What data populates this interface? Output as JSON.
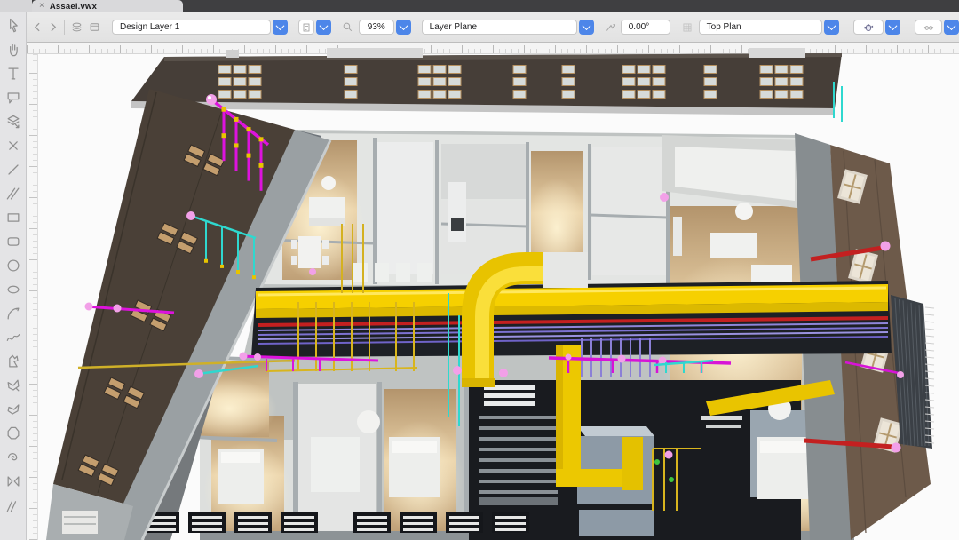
{
  "window": {
    "tab_title": "Assael.vwx",
    "close_glyph": "×"
  },
  "toolbar": {
    "accent": "#4d86e9",
    "layer_select": "Design Layer 1",
    "zoom_level": "93%",
    "plane_select": "Layer Plane",
    "rotation_angle": "0.00°",
    "view_select": "Top Plan"
  },
  "palette": {
    "tools": [
      {
        "id": "selection"
      },
      {
        "id": "pan"
      },
      {
        "id": "text"
      },
      {
        "id": "callout"
      },
      {
        "id": "working-plane"
      },
      {
        "id": "delete"
      },
      {
        "id": "line"
      },
      {
        "id": "double-line"
      },
      {
        "id": "rectangle"
      },
      {
        "id": "rounded-rectangle"
      },
      {
        "id": "circle"
      },
      {
        "id": "ellipse"
      },
      {
        "id": "arc"
      },
      {
        "id": "freehand"
      },
      {
        "id": "polyline"
      },
      {
        "id": "reshape-polygon"
      },
      {
        "id": "polygon"
      },
      {
        "id": "regular-polygon"
      },
      {
        "id": "spiral"
      },
      {
        "id": "mirror"
      },
      {
        "id": "hatch"
      }
    ]
  },
  "scene": {
    "colors": {
      "duct_yellow": "#f2cc00",
      "duct_yellow_dark": "#d9b400",
      "pipe_magenta": "#dd13dd",
      "pipe_cyan": "#2fd8cf",
      "pipe_red": "#c32020",
      "pipe_purple": "#8b80d6",
      "pipe_thin_yellow": "#d8b51e",
      "sphere_pink": "#f2a0e8",
      "facade_roof_dark": "#463e38",
      "facade_wood_brown": "#4a4037",
      "facade_brick_brown": "#6d5a4a",
      "floor_wood": "#c3a37d",
      "wall_gray": "#9aa0a3",
      "corridor_dark": "#1d2025",
      "window_frame_tan": "#c49e6e"
    }
  }
}
